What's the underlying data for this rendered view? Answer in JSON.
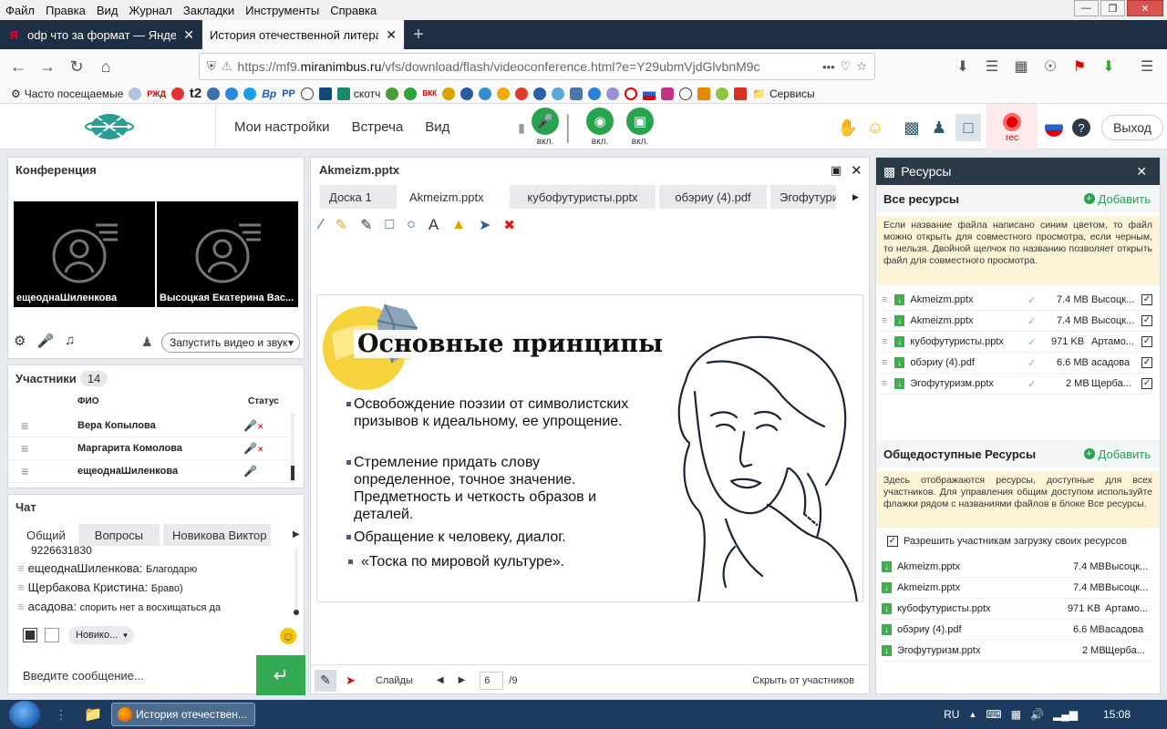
{
  "browser": {
    "menu": [
      "Файл",
      "Правка",
      "Вид",
      "Журнал",
      "Закладки",
      "Инструменты",
      "Справка"
    ],
    "tabs": [
      {
        "label": "odp что за формат — Яндекс"
      },
      {
        "label": "История отечественной литерату"
      }
    ],
    "url_host": "https://mf9.",
    "url_domain": "miranimbus.ru",
    "url_path": "/vfs/download/flash/videoconference.html?e=Y29ubmVjdGlvbnM9c",
    "bookmarks": {
      "frequent": "Часто посещаемые",
      "t2": "t2",
      "scotch": "скотч",
      "services": "Сервисы"
    }
  },
  "app": {
    "menu": [
      "Мои настройки",
      "Встреча",
      "Вид"
    ],
    "mic_label": "вкл.",
    "cam_label": "вкл.",
    "screen_label": "вкл.",
    "rec_label": "rec",
    "exit_label": "Выход"
  },
  "conference": {
    "title": "Конференция",
    "videos": [
      "ещеоднаШиленкова",
      "Высоцкая Екатерина  Вас..."
    ],
    "start_video": "Запустить видео и звук"
  },
  "participants": {
    "title": "Участники",
    "count": "14",
    "col_name": "ФИО",
    "col_status": "Статус",
    "rows": [
      {
        "name": "Вера Копылова",
        "muted": true
      },
      {
        "name": "Маргарита Комолова",
        "muted": true
      },
      {
        "name": "ещеоднаШиленкова",
        "muted": false
      }
    ]
  },
  "chat": {
    "title": "Чат",
    "tabs": [
      "Общий",
      "Вопросы",
      "Новикова Виктор"
    ],
    "messages": [
      {
        "author": "",
        "text": "9226631830"
      },
      {
        "author": "ещеоднаШиленкова:",
        "text": "Благодарю"
      },
      {
        "author": "Щербакова Кристина:",
        "text": "Браво)"
      },
      {
        "author": "асадова:",
        "text": "спорить нет а восхищаться да"
      }
    ],
    "recipient": "Новико...",
    "input_placeholder": "Введите сообщение..."
  },
  "presentation": {
    "title": "Akmeizm.pptx",
    "tabs": [
      "Доска 1",
      "Akmeizm.pptx",
      "кубофутуристы.pptx",
      "обэриу (4).pdf",
      "Эгофутуриз"
    ],
    "slide_title": "Основные принципы",
    "bullets": [
      "Освобождение поэзии от символистских призывов к идеальному, ее упрощение.",
      "Стремление придать слову определенное, точное значение. Предметность и четкость образов и деталей.",
      "Обращение к человеку, диалог.",
      " «Тоска по мировой культуре»."
    ],
    "slides_label": "Слайды",
    "page": "6",
    "total": "/9",
    "hide_label": "Скрыть от участников"
  },
  "resources": {
    "title": "Ресурсы",
    "all_title": "Все ресурсы",
    "add_label": "Добавить",
    "all_note": "Если название файла написано синим цветом, то файл можно открыть для совместного просмотра, если черным, то нельзя. Двойной щелчок по названию позволяет открыть файл для совместного просмотра.",
    "all_files": [
      {
        "name": "Akmeizm.pptx",
        "size": "7.4 MB",
        "owner": "Высоцк..."
      },
      {
        "name": "Akmeizm.pptx",
        "size": "7.4 MB",
        "owner": "Высоцк..."
      },
      {
        "name": "кубофутуристы.pptx",
        "size": "971 KB",
        "owner": "Артамо..."
      },
      {
        "name": "обэриу (4).pdf",
        "size": "6.6 MB",
        "owner": "асадова"
      },
      {
        "name": "Эгофутуризм.pptx",
        "size": "2 MB",
        "owner": "Щерба..."
      }
    ],
    "public_title": "Общедоступные Ресурсы",
    "public_note": "Здесь отображаются ресурсы, доступные для всех участников. Для управления общим доступом используйте флажки рядом с названиями файлов в блоке Все ресурсы.",
    "allow_upload": "Разрешить участникам загрузку своих ресурсов",
    "public_files": [
      {
        "name": "Akmeizm.pptx",
        "size": "7.4 MB",
        "owner": "Высоцк..."
      },
      {
        "name": "Akmeizm.pptx",
        "size": "7.4 MB",
        "owner": "Высоцк..."
      },
      {
        "name": "кубофутуристы.pptx",
        "size": "971 KB",
        "owner": "Артамо..."
      },
      {
        "name": "обэриу (4).pdf",
        "size": "6.6 MB",
        "owner": "асадова"
      },
      {
        "name": "Эгофутуризм.pptx",
        "size": "2 MB",
        "owner": "Щерба..."
      }
    ]
  },
  "taskbar": {
    "app_label": "История отечествен...",
    "lang": "RU",
    "time": "15:08"
  },
  "colors": {
    "accent_green": "#27a34e",
    "header_dark": "#2c3947",
    "rec_red": "#dd0000"
  }
}
